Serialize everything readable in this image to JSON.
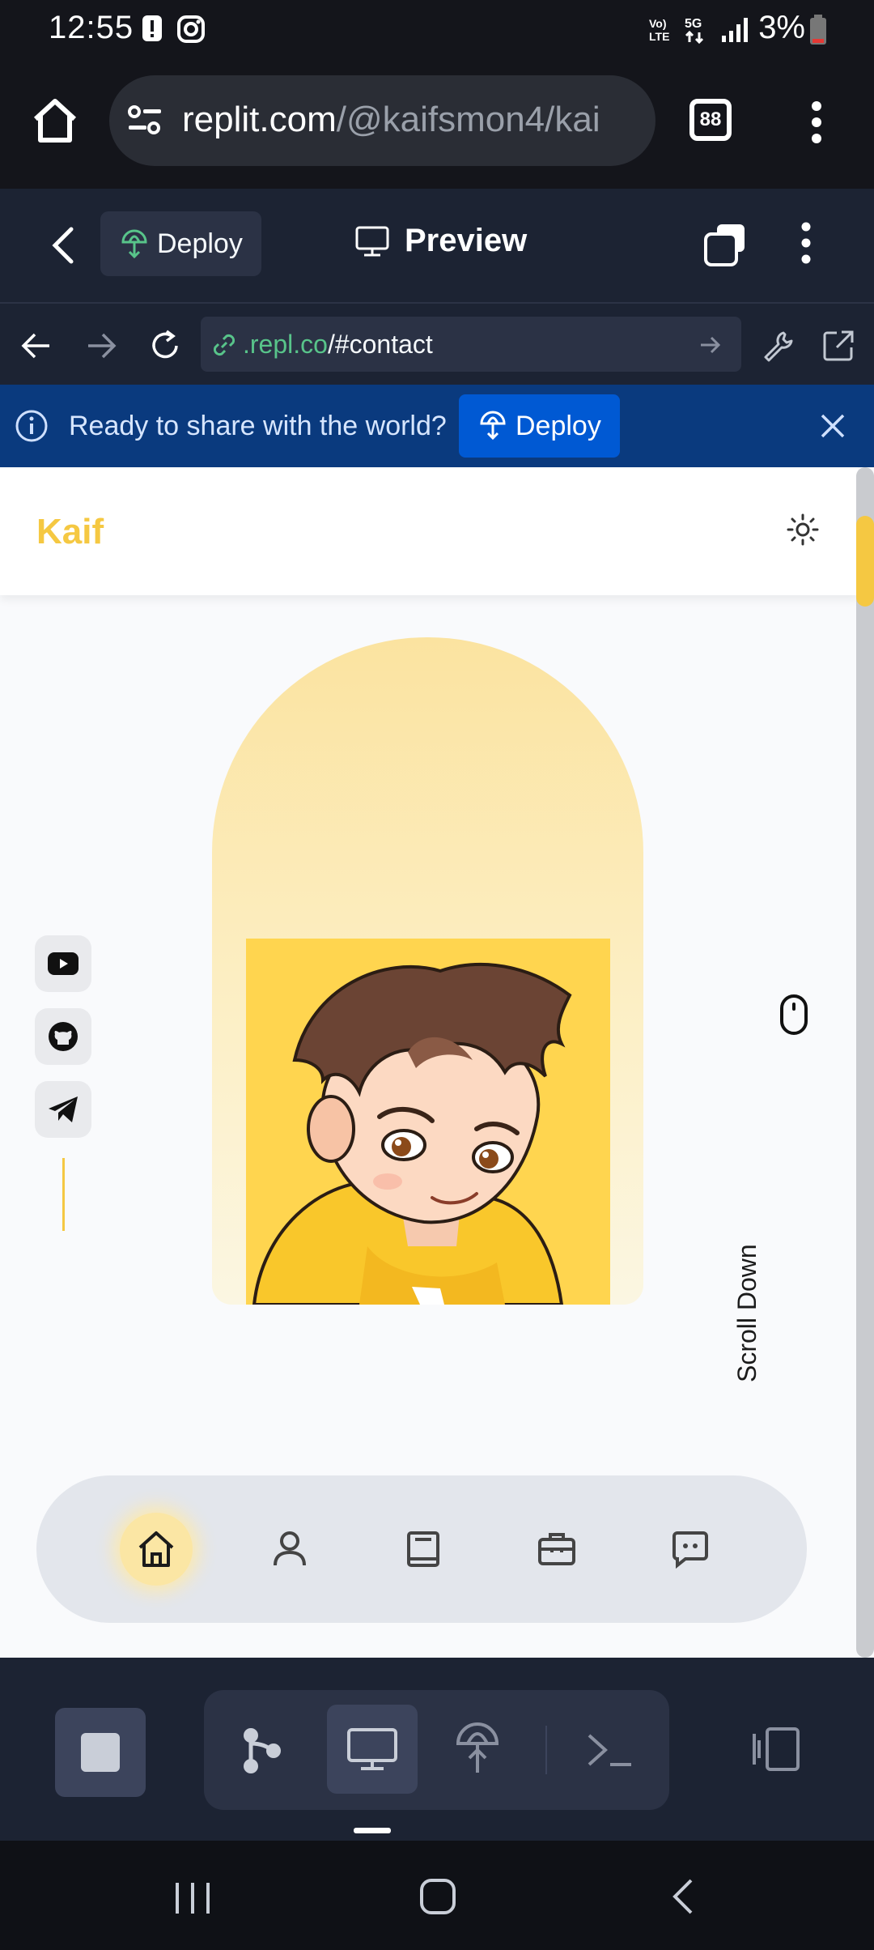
{
  "status_bar": {
    "time": "12:55",
    "battery": "3%"
  },
  "browser": {
    "url_domain": "replit.com",
    "url_path": "/@kaifsmon4/kai",
    "tabs_count": "88"
  },
  "replit_header": {
    "deploy_label": "Deploy",
    "preview_label": "Preview"
  },
  "inner_nav": {
    "url_domain": ".repl.co",
    "url_path": "/#contact"
  },
  "banner": {
    "message": "Ready to share with the world?",
    "deploy_label": "Deploy"
  },
  "site": {
    "logo": "Kaif",
    "scroll_hint": "Scroll Down",
    "social": [
      "youtube-icon",
      "github-icon",
      "telegram-icon"
    ],
    "bottom_nav": [
      "home-icon",
      "user-icon",
      "book-icon",
      "briefcase-icon",
      "chat-icon"
    ]
  },
  "colors": {
    "accent": "#f5c842",
    "replit_bg": "#1c2333",
    "banner_bg": "#0a3a7e",
    "banner_button": "#0059d3"
  }
}
